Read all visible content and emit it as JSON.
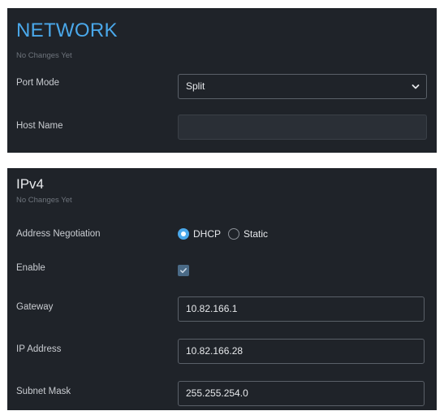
{
  "network": {
    "title": "NETWORK",
    "status": "No Changes Yet",
    "port_mode": {
      "label": "Port Mode",
      "value": "Split"
    },
    "host_name": {
      "label": "Host Name",
      "value": ""
    }
  },
  "ipv4": {
    "title": "IPv4",
    "status": "No Changes Yet",
    "address_negotiation": {
      "label": "Address Negotiation",
      "options": [
        "DHCP",
        "Static"
      ],
      "selected": "DHCP"
    },
    "enable": {
      "label": "Enable",
      "checked": true
    },
    "gateway": {
      "label": "Gateway",
      "value": "10.82.166.1"
    },
    "ip_address": {
      "label": "IP Address",
      "value": "10.82.166.28"
    },
    "subnet_mask": {
      "label": "Subnet Mask",
      "value": "255.255.254.0"
    }
  },
  "colors": {
    "accent": "#4aa8ea",
    "panel_bg": "#1f2329"
  },
  "icons": {
    "select": "chevron-down-icon",
    "checkbox": "checkmark-icon"
  }
}
